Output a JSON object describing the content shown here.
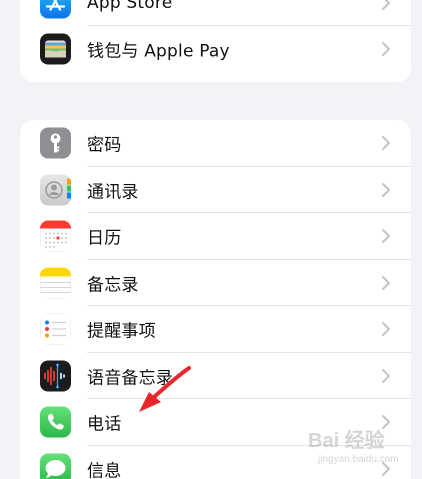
{
  "settings": {
    "group_top": [
      {
        "label": "App Store",
        "icon": "app-store-icon",
        "color": "#1a8cff"
      },
      {
        "label": "钱包与 Apple Pay",
        "icon": "wallet-icon",
        "color": "#1c1c1e"
      }
    ],
    "group_apps": [
      {
        "label": "密码",
        "icon": "key-icon",
        "color": "#8e8e93"
      },
      {
        "label": "通讯录",
        "icon": "contacts-icon",
        "color": "#d8d8d8"
      },
      {
        "label": "日历",
        "icon": "calendar-icon",
        "color": "#ffffff"
      },
      {
        "label": "备忘录",
        "icon": "notes-icon",
        "color": "#ffd60a"
      },
      {
        "label": "提醒事项",
        "icon": "reminders-icon",
        "color": "#ffffff"
      },
      {
        "label": "语音备忘录",
        "icon": "voice-memos-icon",
        "color": "#1c1c1e"
      },
      {
        "label": "电话",
        "icon": "phone-icon",
        "color": "#34c759"
      },
      {
        "label": "信息",
        "icon": "messages-icon",
        "color": "#34c759"
      }
    ]
  },
  "annotation": {
    "arrow_color": "#e8262b",
    "arrow_target": "电话"
  },
  "watermark": {
    "line1": "Bai 经验",
    "line2": "jingyan.baidu.com"
  }
}
